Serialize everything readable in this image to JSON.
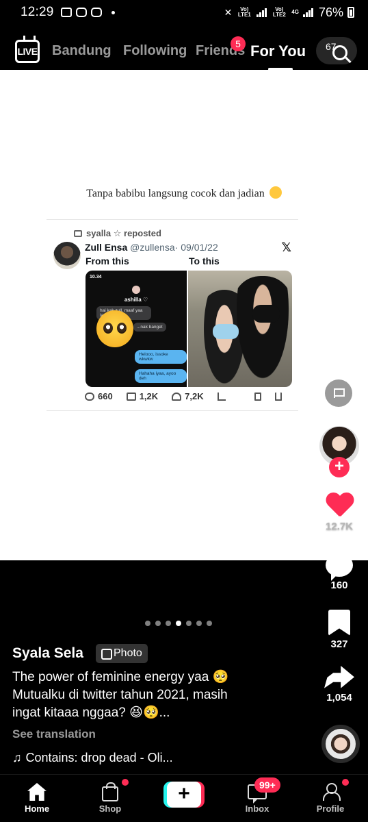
{
  "status_bar": {
    "time": "12:29",
    "battery": "76%",
    "net1": "Vo) LTE1",
    "net2": "Vo) LTE2",
    "net_type": "4G"
  },
  "top_nav": {
    "live_label": "LIVE",
    "tabs": [
      "Bandung",
      "Following",
      "Friends",
      "For You"
    ],
    "active_tab": "For You",
    "friends_badge": "5",
    "search_hint": "67"
  },
  "post": {
    "overlay_caption": "Tanpa babibu langsung cocok dan jadian",
    "tweet": {
      "reposted_by": "syalla ☆ reposted",
      "author": "Zull Ensa",
      "handle": "@zullensa",
      "date": "· 09/01/22",
      "x_logo": "𝕏",
      "label_left": "From this",
      "label_right": "To this",
      "chat": {
        "time": "10.34",
        "name": "ashilla ♡",
        "in_msg_1": "hai kak zull, maaf yaa lang...",
        "in_msg_2": "...nak banget",
        "out_msg_1": "Helooo, issoke wkwkw",
        "out_msg_2": "Hahaha iyaa, ayoo deh"
      },
      "replies": "660",
      "retweets": "1,2K",
      "likes": "7,2K"
    }
  },
  "rail": {
    "likes": "12.7K",
    "comments": "160",
    "saves": "327",
    "shares": "1,054",
    "follow_symbol": "+"
  },
  "details": {
    "author": "Syala Sela",
    "badge": "Photo",
    "description_line1": "The power of feminine energy yaa 🥺",
    "description_line2": "Mutualku di twitter tahun 2021, masih",
    "description_line3": "ingat kitaaa nggaa? 😆🥺...",
    "see_translation": "See translation",
    "music": "Contains: drop dead - Oli...",
    "music_note": "♫",
    "page_dots_total": 7,
    "page_dot_active": 4
  },
  "tab_bar": {
    "home": "Home",
    "shop": "Shop",
    "create": "+",
    "inbox": "Inbox",
    "inbox_badge": "99+",
    "profile": "Profile"
  },
  "colors": {
    "accent": "#fe2c55",
    "cyan": "#25f4ee",
    "background": "#000000"
  }
}
